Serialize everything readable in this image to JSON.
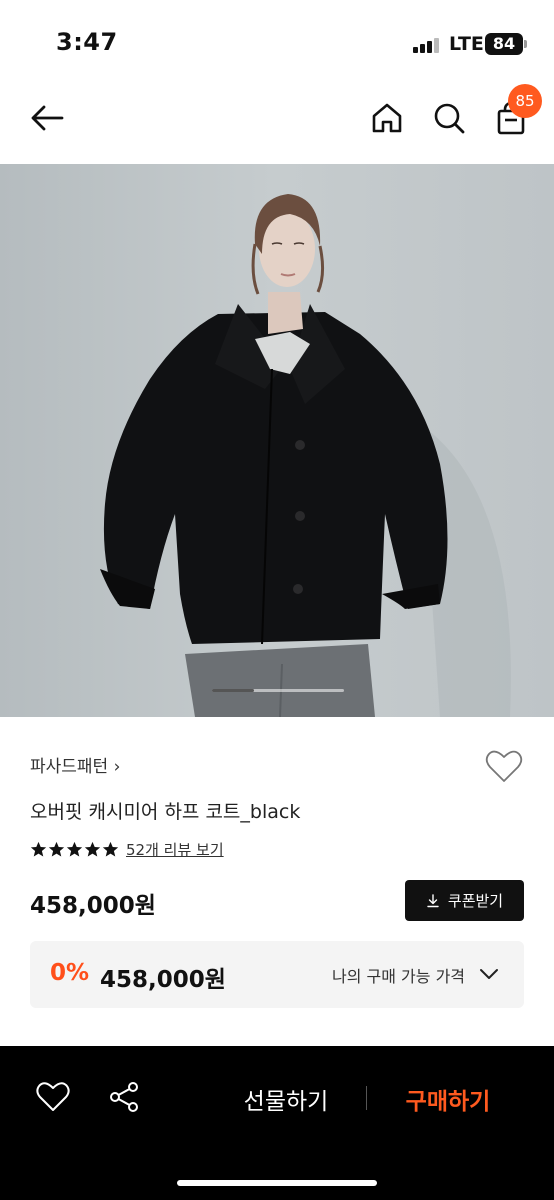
{
  "status_bar": {
    "time": "3:47",
    "network": "LTE",
    "battery": "84"
  },
  "header": {
    "cart_count": "85"
  },
  "product": {
    "brand": "파사드패턴",
    "brand_chevron": "›",
    "name": "오버핏 캐시미어 하프 코트_black",
    "rating_stars": 5,
    "review_link": "52개 리뷰 보기",
    "price": "458,000원",
    "coupon_label": "쿠폰받기",
    "discount_rate": "0%",
    "my_price": "458,000원",
    "my_price_label": "나의 구매 가능 가격"
  },
  "gallery": {
    "active_index": 1,
    "count": 3
  },
  "bottom_bar": {
    "gift_label": "선물하기",
    "buy_label": "구매하기"
  },
  "colors": {
    "accent": "#ff5a1f",
    "discount": "#ff4f1a",
    "bottom_bar_bg": "#000000"
  }
}
